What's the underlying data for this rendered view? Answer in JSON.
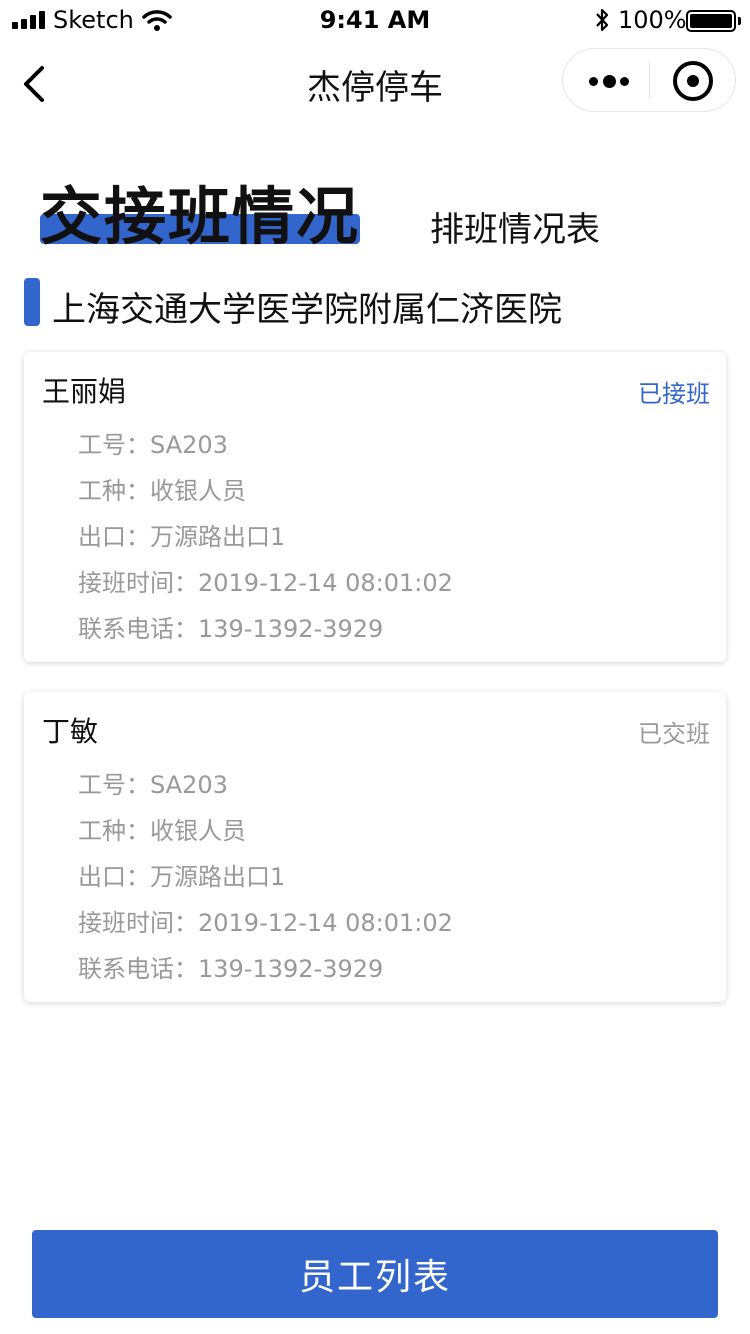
{
  "status_bar": {
    "carrier": "Sketch",
    "time": "9:41 AM",
    "battery": "100%"
  },
  "nav": {
    "title": "杰停停车",
    "icons": [
      "back-chevron-icon",
      "more-dots-icon",
      "target-icon"
    ]
  },
  "header": {
    "title": "交接班情况",
    "subtitle_link": "排班情况表"
  },
  "section": {
    "title": "上海交通大学医学院附属仁济医院"
  },
  "colors": {
    "accent": "#3366cc",
    "muted": "#999999"
  },
  "cards": [
    {
      "name": "王丽娟",
      "status": "已接班",
      "rows": [
        "工号：SA203",
        "工种：收银人员",
        "出口：万源路出口1",
        "接班时间：2019-12-14  08:01:02",
        "联系电话：139-1392-3929"
      ]
    },
    {
      "name": "丁敏",
      "status": "已交班",
      "rows": [
        "工号：SA203",
        "工种：收银人员",
        "出口：万源路出口1",
        "接班时间：2019-12-14  08:01:02",
        "联系电话：139-1392-3929"
      ]
    }
  ],
  "footer": {
    "button_label": "员工列表"
  }
}
